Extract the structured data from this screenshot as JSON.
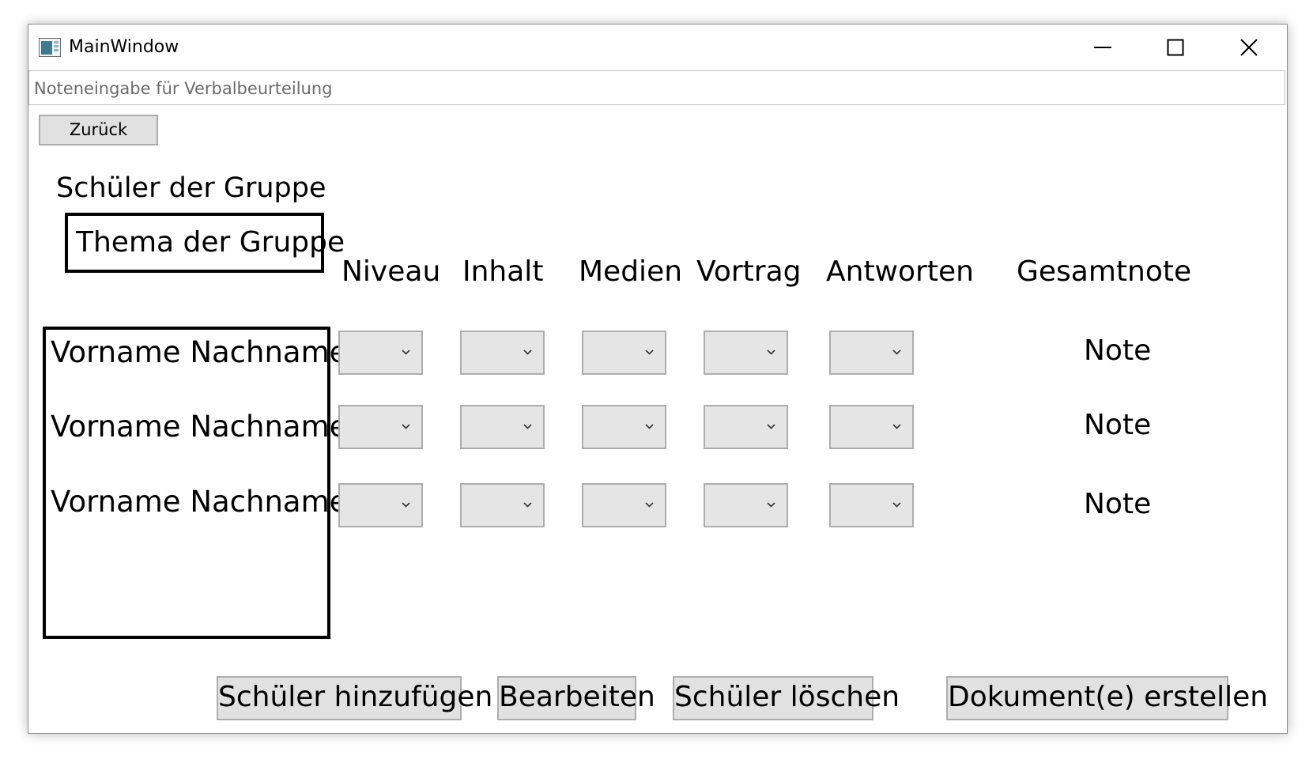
{
  "window": {
    "title": "MainWindow",
    "app_icon": "window-app-icon",
    "controls": [
      "minimize-icon",
      "maximize-icon",
      "close-icon"
    ]
  },
  "textbox": {
    "text": "Noteneingabe für Verbalbeurteilung"
  },
  "back_button": "Zurück",
  "group_title": "Schüler der Gruppe",
  "topic": "Thema der Gruppe",
  "columns": [
    "Niveau",
    "Inhalt",
    "Medien",
    "Vortrag",
    "Antworten",
    "Gesamtnote"
  ],
  "students": [
    {
      "name": "Vorname Nachname",
      "grade": "Note"
    },
    {
      "name": "Vorname Nachname",
      "grade": "Note"
    },
    {
      "name": "Vorname Nachname",
      "grade": "Note"
    }
  ],
  "buttons": {
    "add": "Schüler hinzufügen",
    "edit": "Bearbeiten",
    "delete": "Schüler löschen",
    "create": "Dokument(e) erstellen"
  }
}
